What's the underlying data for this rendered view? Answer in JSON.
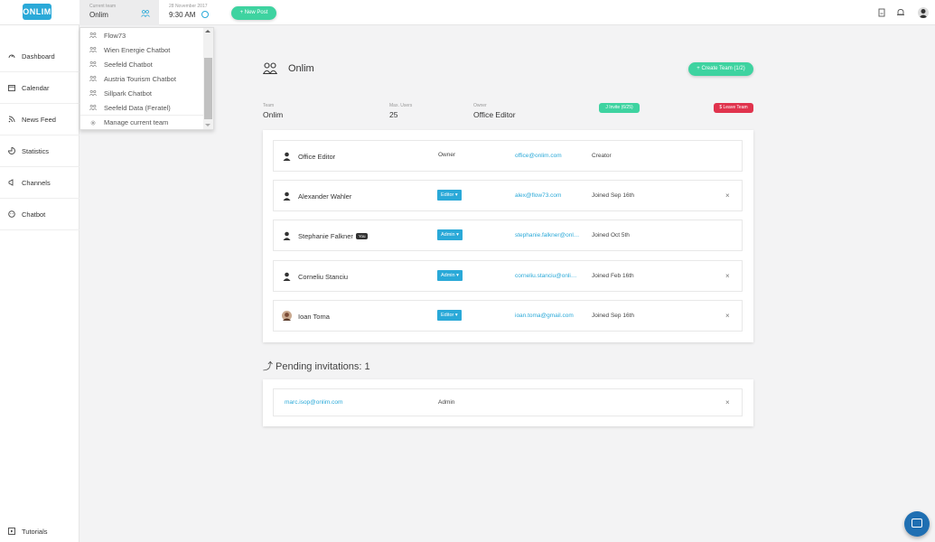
{
  "app": {
    "logo": "ONLIM"
  },
  "topbar": {
    "team_caption": "Current team",
    "team_value": "Onlim",
    "date_caption": "28 November 2017",
    "time_value": "9:30 AM",
    "new_post_label": "+ New Post"
  },
  "sidebar": {
    "items": [
      {
        "label": "Dashboard",
        "icon": "dashboard-icon"
      },
      {
        "label": "Calendar",
        "icon": "calendar-icon"
      },
      {
        "label": "News Feed",
        "icon": "newsfeed-icon"
      },
      {
        "label": "Statistics",
        "icon": "statistics-icon"
      },
      {
        "label": "Channels",
        "icon": "channels-icon"
      },
      {
        "label": "Chatbot",
        "icon": "chatbot-icon"
      }
    ],
    "bottom": {
      "label": "Tutorials",
      "icon": "tutorials-icon"
    }
  },
  "dropdown": {
    "items": [
      "Flow73",
      "Wien Energie Chatbot",
      "Seefeld Chatbot",
      "Austria Tourism Chatbot",
      "Sillpark Chatbot",
      "Seefeld Data (Feratel)"
    ],
    "manage_label": "Manage current team"
  },
  "team": {
    "title": "Onlim",
    "create_label": "+ Create Team (1/2)",
    "team_caption": "Team",
    "team_value": "Onlim",
    "max_users_caption": "Max. Users",
    "max_users_value": "25",
    "owner_caption": "Owner",
    "owner_value": "Office Editor",
    "invite_label": "J Invite (6/25)",
    "leave_label": "$ Leave Team"
  },
  "members": [
    {
      "name": "Office Editor",
      "role": "Owner",
      "role_is_button": false,
      "email": "office@onlim.com",
      "joined": "Creator",
      "removable": false,
      "you": false
    },
    {
      "name": "Alexander Wahler",
      "role": "Editor ▾",
      "role_is_button": true,
      "email": "alex@flow73.com",
      "joined": "Joined Sep 16th",
      "removable": true,
      "you": false
    },
    {
      "name": "Stephanie Falkner",
      "role": "Admin ▾",
      "role_is_button": true,
      "email": "stephanie.falkner@onlim.com",
      "joined": "Joined Oct 5th",
      "removable": false,
      "you": true,
      "you_label": "You"
    },
    {
      "name": "Corneliu Stanciu",
      "role": "Admin ▾",
      "role_is_button": true,
      "email": "corneliu.stanciu@onlim.com",
      "joined": "Joined Feb 16th",
      "removable": true,
      "you": false
    },
    {
      "name": "Ioan Toma",
      "role": "Editor ▾",
      "role_is_button": true,
      "email": "ioan.toma@gmail.com",
      "joined": "Joined Sep 16th",
      "removable": true,
      "you": false
    }
  ],
  "pending": {
    "title": "⤴ Pending invitations: 1",
    "items": [
      {
        "email": "marc.isop@onlim.com",
        "role": "Admin"
      }
    ]
  },
  "colors": {
    "accent": "#2aa9d8",
    "green": "#3ed3a0",
    "danger": "#e0334d",
    "chat": "#1f6fb2"
  }
}
